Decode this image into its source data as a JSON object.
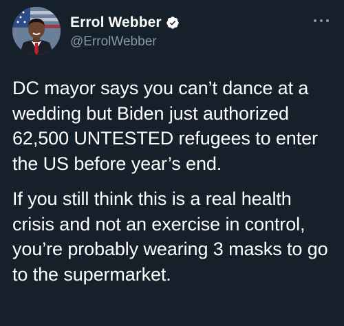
{
  "author": {
    "display_name": "Errol Webber",
    "handle": "@ErrolWebber",
    "verified": true
  },
  "icons": {
    "verified": "verified-badge-icon",
    "more": "more-options-icon",
    "avatar": "profile-photo"
  },
  "tweet": {
    "paragraphs": [
      "DC mayor says you can’t dance at a wedding but Biden just authorized 62,500 UNTESTED refugees to enter the US before year’s end.",
      "If you still think this is a real health crisis and not an exercise in control, you’re probably wearing 3 masks to go to the supermarket."
    ]
  },
  "colors": {
    "background": "#15202b",
    "text": "#ffffff",
    "secondary_text": "#8899a6",
    "verified_badge": "#ffffff"
  }
}
